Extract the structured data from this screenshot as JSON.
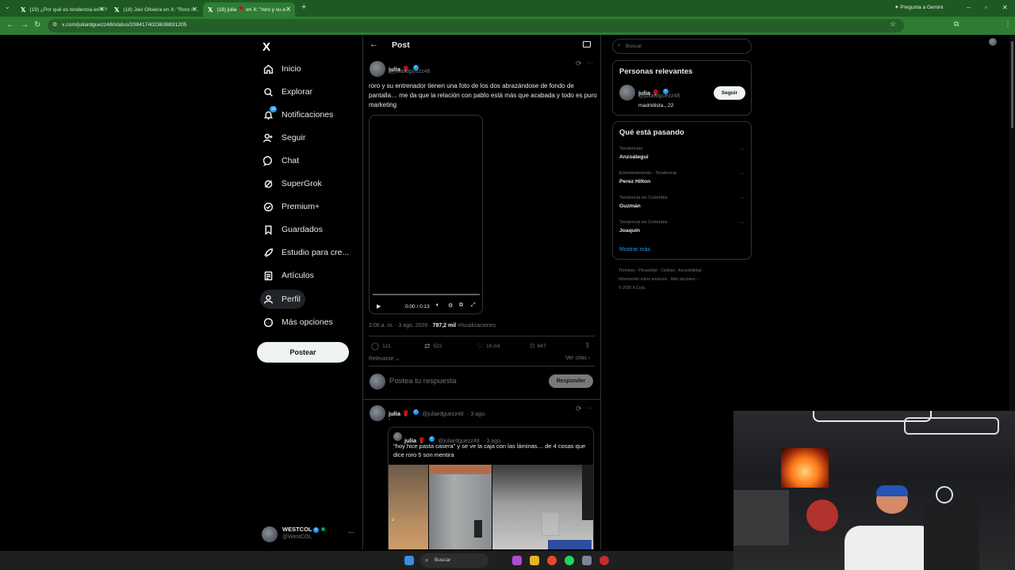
{
  "browser": {
    "tabs": [
      {
        "title": "(19) ¿Por qué es tendencia en X?",
        "active": false
      },
      {
        "title": "(18) Javi Oliveira en X: \"Roro n…",
        "active": false
      },
      {
        "title": "(18) julia 🌹 en X: \"roro y su e…",
        "active": true
      }
    ],
    "url": "x.com/juliardguezz48/status/2084174023638831205",
    "gemini_label": "Pregunta a Gemini"
  },
  "sidebar": {
    "brand": "X",
    "items": [
      {
        "label": "Inicio",
        "icon": "home-icon"
      },
      {
        "label": "Explorar",
        "icon": "search-icon"
      },
      {
        "label": "Notificaciones",
        "icon": "bell-icon",
        "badge": "16"
      },
      {
        "label": "Seguir",
        "icon": "follow-icon"
      },
      {
        "label": "Chat",
        "icon": "chat-icon"
      },
      {
        "label": "SuperGrok",
        "icon": "grok-icon"
      },
      {
        "label": "Premium+",
        "icon": "premium-icon"
      },
      {
        "label": "Guardados",
        "icon": "bookmark-icon"
      },
      {
        "label": "Estudio para cre...",
        "icon": "rocket-icon"
      },
      {
        "label": "Artículos",
        "icon": "articles-icon"
      },
      {
        "label": "Perfil",
        "icon": "profile-icon"
      },
      {
        "label": "Más opciones",
        "icon": "more-icon"
      }
    ],
    "post_button": "Postear",
    "account": {
      "name": "WESTCOL",
      "handle": "@WestCOL"
    }
  },
  "main": {
    "header_title": "Post",
    "post": {
      "name": "julia 🌹",
      "handle": "@juliardguezz48",
      "text": "roro y su entrenador tienen una foto de los dos abrazándose de fondo de pantalla… me da que la relación con pablo está más que acabada y todo es puro marketing",
      "video_time": "0:00 / 0:13",
      "timestamp": "2:06 a. m. · 3 ago. 2026 ·",
      "views_count": "787,2 mil",
      "views_label": "Visualizaciones",
      "replies": "121",
      "reposts": "522",
      "likes": "10 mil",
      "bookmarks": "847"
    },
    "sort_label": "Relevante",
    "quotes_link": "Ver citas",
    "reply_placeholder": "Postea tu respuesta",
    "reply_button": "Responder",
    "reply_post": {
      "name": "julia 🌹",
      "handle": "@juliardguezz48",
      "date": "· 3 ago.",
      "text": ".",
      "quoted": {
        "name": "julia 🌹",
        "handle": "@juliardguezz48",
        "date": "· 3 ago.",
        "text": "\"hoy hice pasta casera\" y se ve la caja con las láminas… de 4 cosas que dice roro 5 son mentira"
      }
    }
  },
  "right": {
    "search_placeholder": "Buscar",
    "relevant_title": "Personas relevantes",
    "relevant_person": {
      "name": "julia 🌹",
      "handle": "@juliardguezz48",
      "bio": "madridista., 22"
    },
    "follow_button": "Seguir",
    "trends_title": "Qué está pasando",
    "trends": [
      {
        "meta": "Tendencias",
        "name": "Anzoátegui"
      },
      {
        "meta": "Entretenimiento · Tendencia",
        "name": "Perez Hilton"
      },
      {
        "meta": "Tendencia en Colombia",
        "name": "Guzmán"
      },
      {
        "meta": "Tendencia en Colombia",
        "name": "Joaquín"
      }
    ],
    "show_more": "Mostrar más",
    "footer_line1": "Términos · Privacidad · Cookies · Accesibilidad ·",
    "footer_line2": "Información sobre anuncios · Más opciones ···",
    "footer_line3": "© 2026 X Corp."
  },
  "taskbar": {
    "search_label": "Buscar"
  }
}
